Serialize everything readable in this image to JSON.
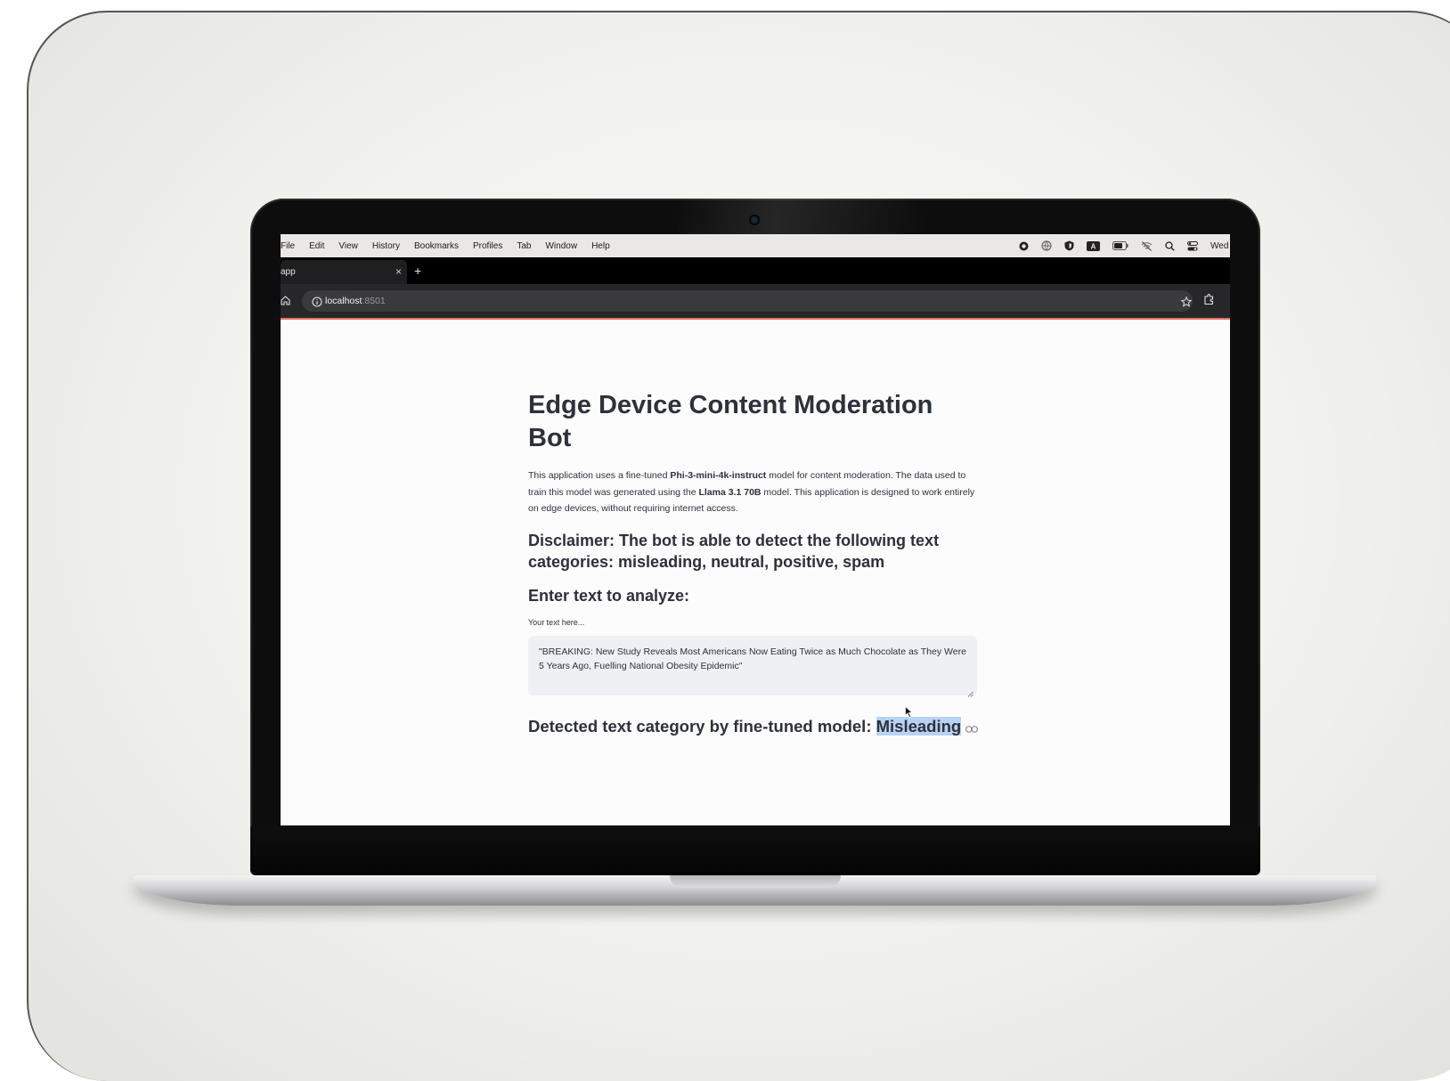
{
  "menubar": {
    "items": [
      "File",
      "Edit",
      "View",
      "History",
      "Bookmarks",
      "Profiles",
      "Tab",
      "Window",
      "Help"
    ],
    "status_icons": [
      "record-icon",
      "globe-icon",
      "shield-icon",
      "keyboard-a-icon",
      "battery-icon",
      "wifi-off-icon",
      "search-icon",
      "control-center-icon"
    ],
    "clock": "Wed"
  },
  "browser": {
    "tab_title": "app",
    "tab_close": "×",
    "new_tab": "+",
    "url_host": "localhost",
    "url_port": ":8501"
  },
  "page": {
    "title": "Edge Device Content Moderation Bot",
    "intro": {
      "part1": "This application uses a fine-tuned ",
      "model": "Phi-3-mini-4k-instruct",
      "part2": " model for content moderation. The data used to train this model was generated using the ",
      "data_model": "Llama 3.1 70B",
      "part3": " model. This application is designed to work entirely on edge devices, without requiring internet access."
    },
    "disclaimer": "Disclaimer: The bot is able to detect the following text categories: misleading, neutral, positive, spam",
    "input_heading": "Enter text to analyze:",
    "input_label": "Your text here...",
    "input_value": "\"BREAKING: New Study Reveals Most Americans Now Eating Twice as Much Chocolate as They Were 5 Years Ago, Fuelling National Obesity Epidemic\"",
    "result_label": "Detected text category by fine-tuned model: ",
    "result_value": "Misleading"
  },
  "colors": {
    "text": "#2e303a",
    "selection": "#b8d2f5",
    "toolbar_accent": "#e0745f"
  }
}
